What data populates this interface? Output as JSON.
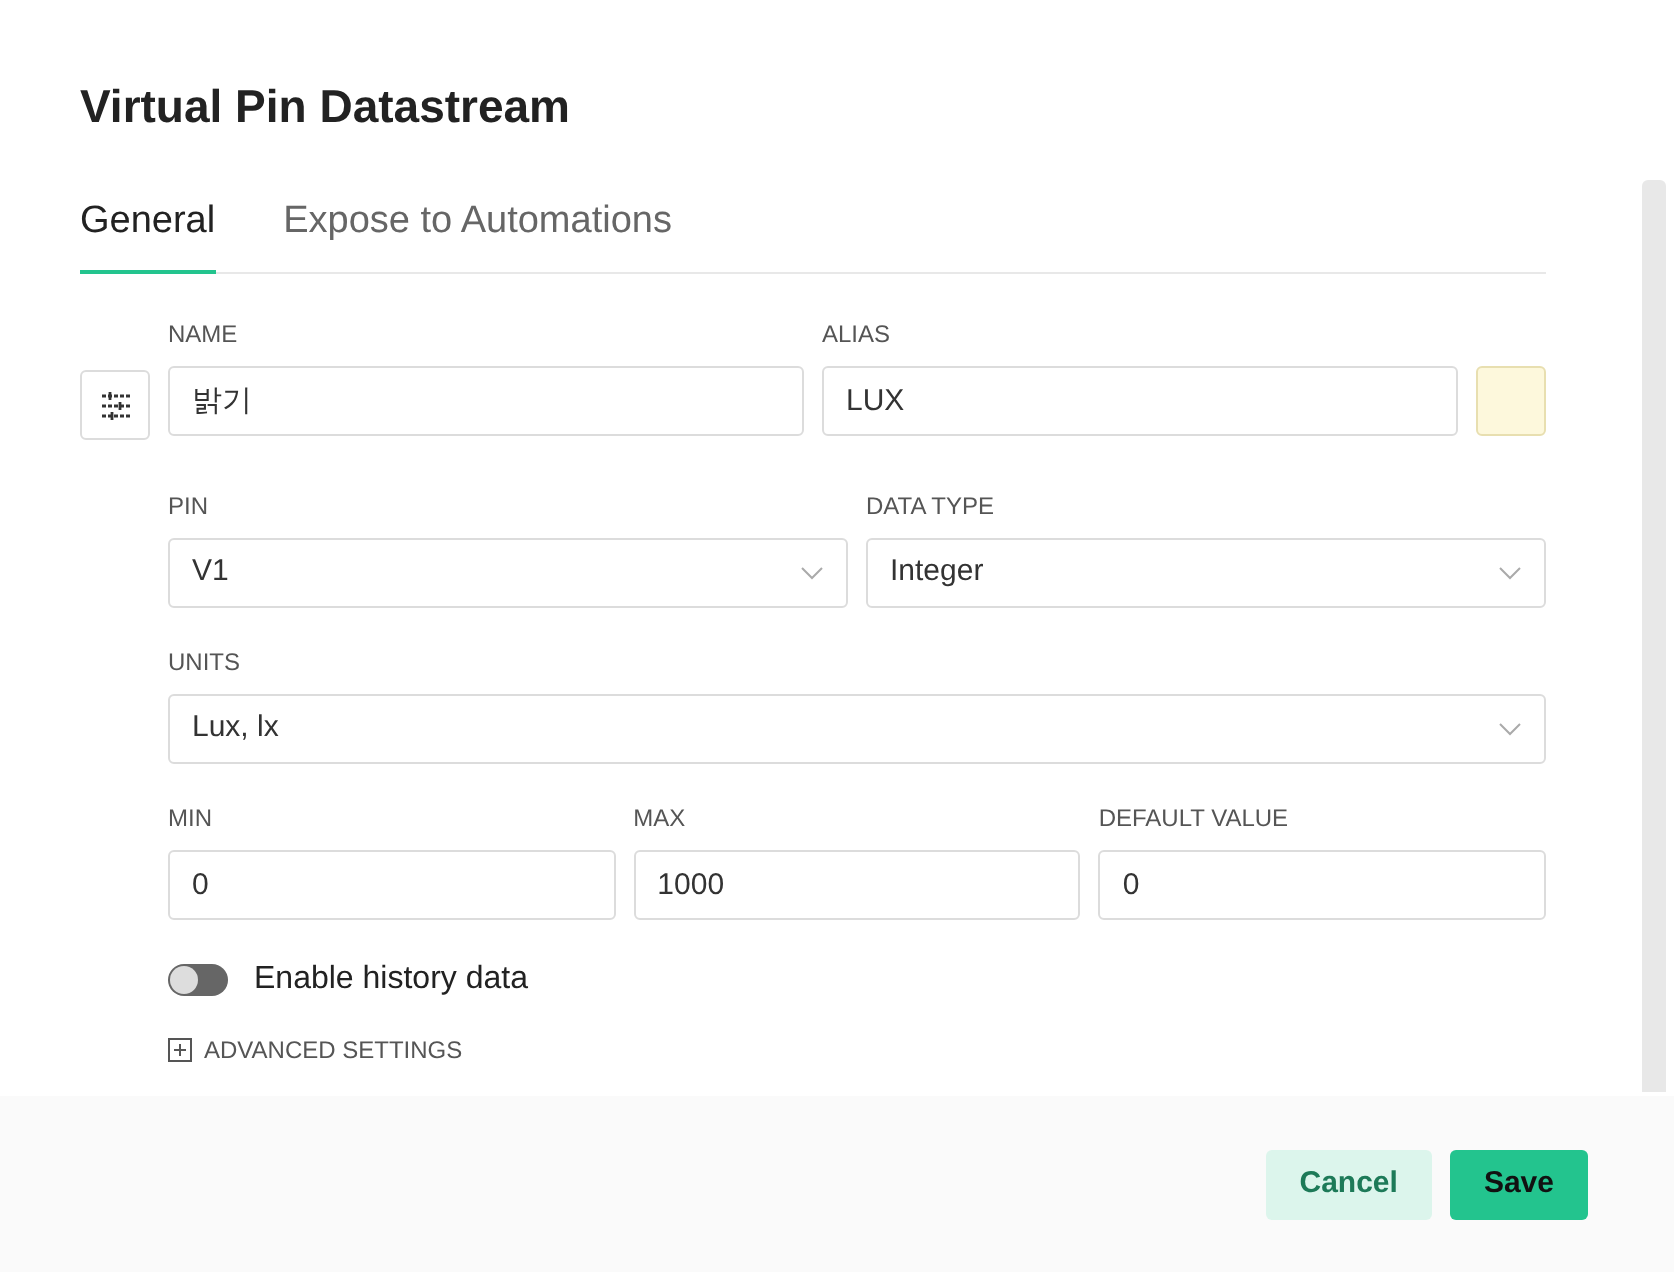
{
  "title": "Virtual Pin Datastream",
  "tabs": [
    {
      "label": "General",
      "selected": true
    },
    {
      "label": "Expose to Automations",
      "selected": false
    }
  ],
  "name": {
    "label": "NAME",
    "value": "밝기"
  },
  "alias": {
    "label": "ALIAS",
    "value": "LUX",
    "color": "#fdf8dc"
  },
  "pin": {
    "label": "PIN",
    "value": "V1"
  },
  "data_type": {
    "label": "DATA TYPE",
    "value": "Integer"
  },
  "units": {
    "label": "UNITS",
    "value": "Lux, lx"
  },
  "range": [
    {
      "label": "MIN",
      "value": "0"
    },
    {
      "label": "MAX",
      "value": "1000"
    },
    {
      "label": "DEFAULT VALUE",
      "value": "0"
    }
  ],
  "history": {
    "label": "Enable history data",
    "on": false
  },
  "advanced": {
    "label": "ADVANCED SETTINGS",
    "expanded": false
  },
  "buttons": [
    {
      "label": "Cancel",
      "kind": "secondary"
    },
    {
      "label": "Save",
      "kind": "primary"
    }
  ]
}
